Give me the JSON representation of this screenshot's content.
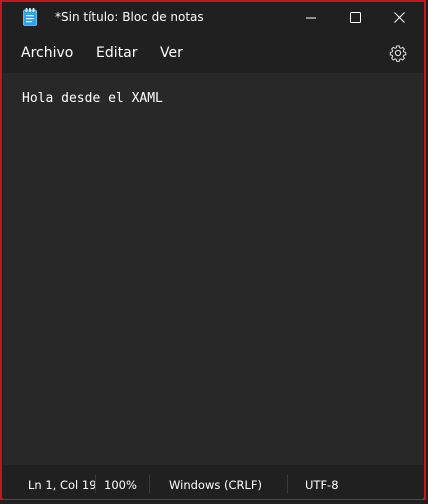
{
  "window": {
    "title": "*Sin título: Bloc de notas",
    "app_icon": "notepad-icon",
    "controls": {
      "minimize_icon": "minimize-icon",
      "maximize_icon": "maximize-icon",
      "close_icon": "close-icon"
    },
    "border_color": "#c5161e"
  },
  "menu": {
    "items": [
      "Archivo",
      "Editar",
      "Ver"
    ],
    "settings_icon": "gear-icon"
  },
  "editor": {
    "content": "Hola desde el XAML",
    "background": "#282828"
  },
  "statusbar": {
    "position": "Ln 1, Col 19",
    "zoom": "100%",
    "line_ending": "Windows (CRLF)",
    "encoding": "UTF-8"
  }
}
